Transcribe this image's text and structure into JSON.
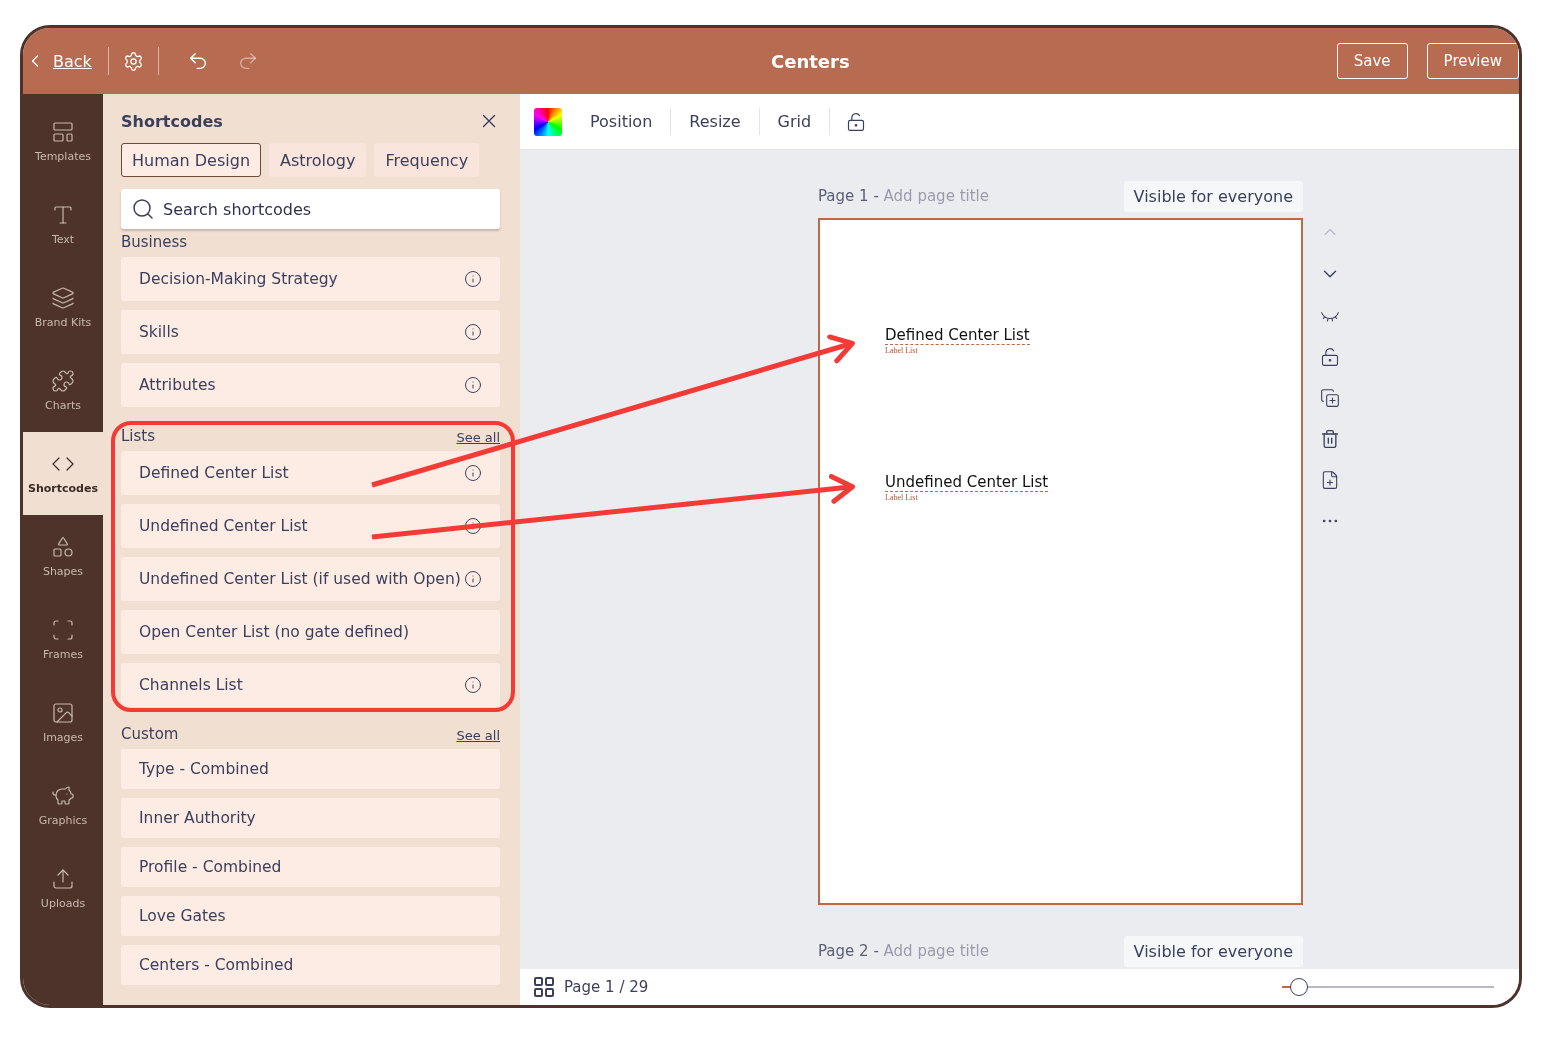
{
  "top_bar": {
    "back": "Back",
    "title": "Centers",
    "redo_disabled": true,
    "buttons": [
      "Save",
      "Preview"
    ]
  },
  "sidebar": {
    "items": [
      {
        "label": "Templates",
        "selected": false
      },
      {
        "label": "Text",
        "selected": false
      },
      {
        "label": "Brand Kits",
        "selected": false
      },
      {
        "label": "Charts",
        "selected": false
      },
      {
        "label": "Shortcodes",
        "selected": true
      },
      {
        "label": "Shapes",
        "selected": false
      },
      {
        "label": "Frames",
        "selected": false
      },
      {
        "label": "Images",
        "selected": false
      },
      {
        "label": "Graphics",
        "selected": false
      },
      {
        "label": "Uploads",
        "selected": false
      }
    ]
  },
  "panel": {
    "title": "Shortcodes",
    "tabs": [
      {
        "label": "Human Design",
        "selected": true
      },
      {
        "label": "Astrology",
        "selected": false
      },
      {
        "label": "Frequency",
        "selected": false
      }
    ],
    "search": {
      "placeholder": "Search shortcodes"
    },
    "sections": [
      {
        "title": "Business",
        "items": [
          {
            "label": "Decision-Making Strategy",
            "info": true
          },
          {
            "label": "Skills",
            "info": true
          },
          {
            "label": "Attributes",
            "info": true
          }
        ]
      },
      {
        "title": "Lists",
        "see_all": "See all",
        "highlighted": true,
        "items": [
          {
            "label": "Defined Center List",
            "info": true
          },
          {
            "label": "Undefined Center List",
            "info": true
          },
          {
            "label": "Undefined Center List (if used with Open)",
            "info": true
          },
          {
            "label": "Open Center List (no gate defined)",
            "info": false
          },
          {
            "label": "Channels List",
            "info": true
          }
        ]
      },
      {
        "title": "Custom",
        "see_all": "See all",
        "items": [
          {
            "label": "Type - Combined",
            "info": false
          },
          {
            "label": "Inner Authority",
            "info": false
          },
          {
            "label": "Profile - Combined",
            "info": false
          },
          {
            "label": "Love Gates",
            "info": false
          },
          {
            "label": "Centers - Combined",
            "info": false
          }
        ]
      }
    ]
  },
  "toolbar": {
    "items": [
      "Position",
      "Resize",
      "Grid"
    ]
  },
  "pages": [
    {
      "label": "Page 1 -",
      "title_placeholder": "Add page title",
      "visibility": "Visible for everyone",
      "elements": [
        {
          "title": "Defined Center List",
          "caption": "Label List"
        },
        {
          "title": "Undefined Center List",
          "caption": "Label List"
        }
      ]
    },
    {
      "label": "Page 2 -",
      "title_placeholder": "Add page title",
      "visibility": "Visible for everyone"
    }
  ],
  "footer": {
    "page_indicator": "Page 1 / 29",
    "zoom": {
      "level": 0.08
    }
  }
}
